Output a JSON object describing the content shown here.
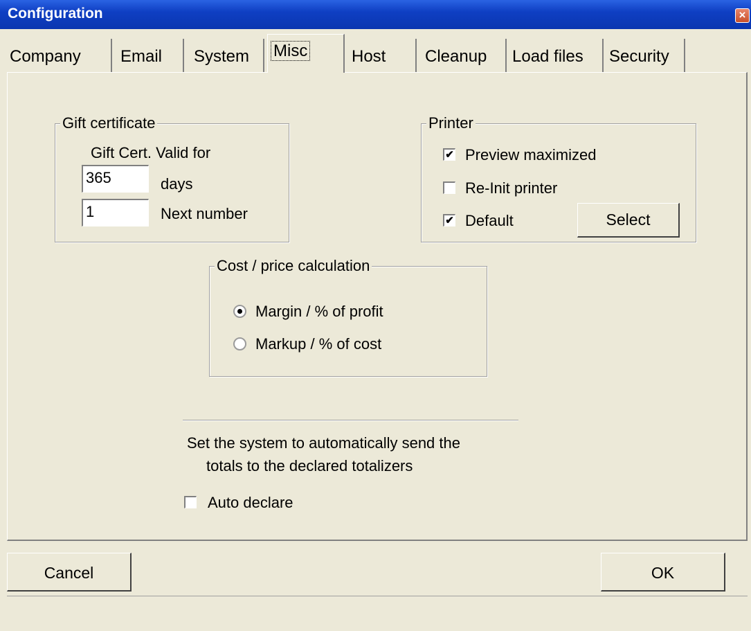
{
  "window": {
    "title": "Configuration",
    "close_glyph": "×"
  },
  "tabs": [
    {
      "label": "Company"
    },
    {
      "label": "Email"
    },
    {
      "label": "System"
    },
    {
      "label": "Misc",
      "active": true
    },
    {
      "label": "Host"
    },
    {
      "label": "Cleanup"
    },
    {
      "label": "Load files"
    },
    {
      "label": "Security"
    }
  ],
  "gift": {
    "title": "Gift certificate",
    "valid_label": "Gift Cert. Valid for",
    "days_value": "365",
    "days_label": "days",
    "next_value": "1",
    "next_label": "Next number"
  },
  "printer": {
    "title": "Printer",
    "preview": {
      "label": "Preview maximized",
      "checked": true
    },
    "reinit": {
      "label": "Re-Init printer",
      "checked": false
    },
    "default": {
      "label": "Default",
      "checked": true
    },
    "select_label": "Select"
  },
  "cost": {
    "title": "Cost / price calculation",
    "margin_label": "Margin / % of profit",
    "markup_label": "Markup / % of cost",
    "selected": "margin"
  },
  "auto": {
    "line1": "Set the system to automatically send the",
    "line2": "totals to the declared totalizers",
    "checkbox_label": "Auto declare",
    "checked": false
  },
  "footer": {
    "cancel_label": "Cancel",
    "ok_label": "OK"
  },
  "check_glyph": "✔"
}
